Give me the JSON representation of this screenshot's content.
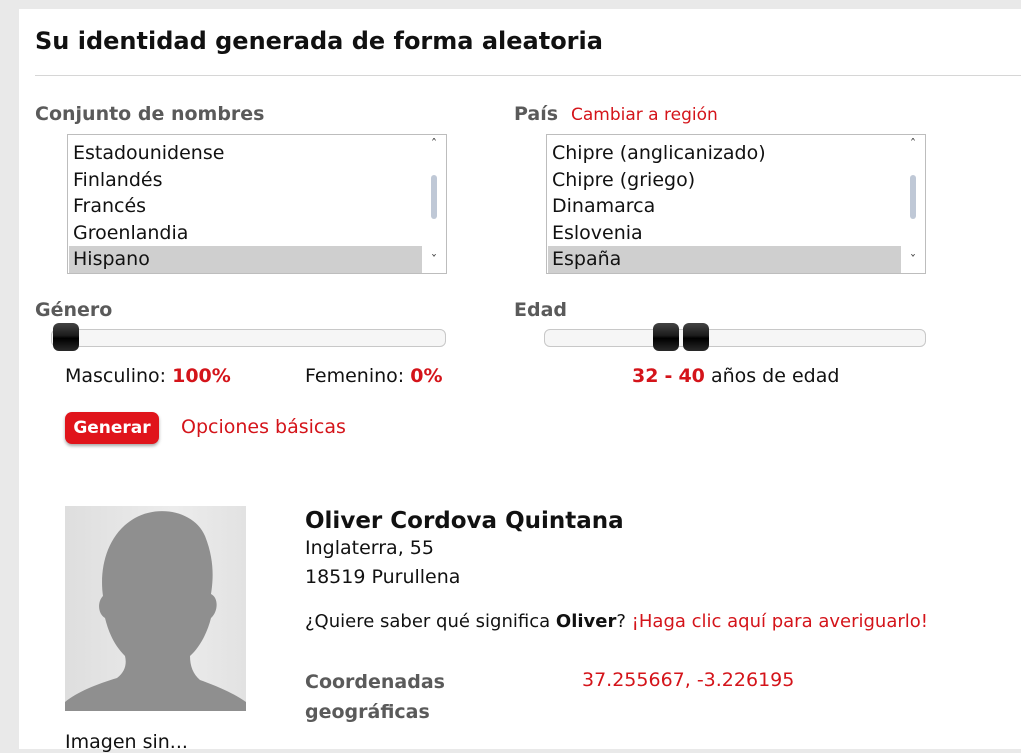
{
  "title": "Su identidad generada de forma aleatoria",
  "name_set": {
    "label": "Conjunto de nombres",
    "options": [
      "Estadounidense",
      "Finlandés",
      "Francés",
      "Groenlandia",
      "Hispano"
    ],
    "selected": "Hispano"
  },
  "country": {
    "label": "País",
    "switch_link": "Cambiar a región",
    "options": [
      "Chipre (anglicanizado)",
      "Chipre (griego)",
      "Dinamarca",
      "Eslovenia",
      "España"
    ],
    "selected": "España"
  },
  "gender": {
    "label": "Género",
    "male_label": "Masculino:",
    "male_value": "100%",
    "female_label": "Femenino:",
    "female_value": "0%",
    "male_fraction": 1.0
  },
  "age": {
    "label": "Edad",
    "min_value": "32",
    "separator": "-",
    "max_value": "40",
    "suffix": "años de edad"
  },
  "actions": {
    "generate": "Generar",
    "basic_options": "Opciones básicas"
  },
  "identity": {
    "full_name": "Oliver Cordova Quintana",
    "address_line1": "Inglaterra, 55",
    "address_line2": "18519 Purullena",
    "meaning_prefix": "¿Quiere saber qué significa",
    "first_name": "Oliver",
    "meaning_suffix": "?",
    "meaning_link": "¡Haga clic aquí para averiguarlo!",
    "coords_label_1": "Coordenadas",
    "coords_label_2": "geográficas",
    "coords_value": "37.255667, -3.226195",
    "image_caption": "Imagen sin..."
  }
}
